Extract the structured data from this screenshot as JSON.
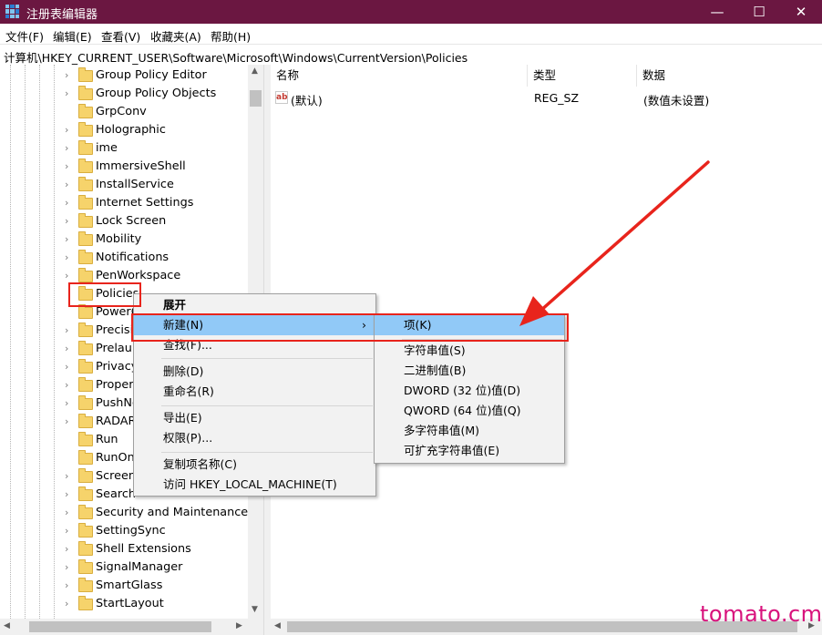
{
  "window": {
    "title": "注册表编辑器",
    "controls": {
      "minimize": "—",
      "maximize": "☐",
      "close": "✕"
    }
  },
  "menubar": {
    "items": [
      {
        "label": "文件(F)"
      },
      {
        "label": "编辑(E)"
      },
      {
        "label": "查看(V)"
      },
      {
        "label": "收藏夹(A)"
      },
      {
        "label": "帮助(H)"
      }
    ]
  },
  "address": {
    "path": "计算机\\HKEY_CURRENT_USER\\Software\\Microsoft\\Windows\\CurrentVersion\\Policies"
  },
  "tree": {
    "items": [
      {
        "label": "Group Policy Editor",
        "expandable": true
      },
      {
        "label": "Group Policy Objects",
        "expandable": true
      },
      {
        "label": "GrpConv",
        "expandable": false
      },
      {
        "label": "Holographic",
        "expandable": true
      },
      {
        "label": "ime",
        "expandable": true
      },
      {
        "label": "ImmersiveShell",
        "expandable": true
      },
      {
        "label": "InstallService",
        "expandable": true
      },
      {
        "label": "Internet Settings",
        "expandable": true
      },
      {
        "label": "Lock Screen",
        "expandable": true
      },
      {
        "label": "Mobility",
        "expandable": true
      },
      {
        "label": "Notifications",
        "expandable": true
      },
      {
        "label": "PenWorkspace",
        "expandable": true
      },
      {
        "label": "Policies",
        "expandable": false,
        "selected": true
      },
      {
        "label": "PowerC",
        "expandable": false
      },
      {
        "label": "Precisio",
        "expandable": true
      },
      {
        "label": "Prelaun",
        "expandable": true
      },
      {
        "label": "Privacy",
        "expandable": true
      },
      {
        "label": "Proper",
        "expandable": true
      },
      {
        "label": "PushNo",
        "expandable": true
      },
      {
        "label": "RADAR",
        "expandable": true
      },
      {
        "label": "Run",
        "expandable": false
      },
      {
        "label": "RunOnc",
        "expandable": false
      },
      {
        "label": "Screen",
        "expandable": true
      },
      {
        "label": "Search",
        "expandable": true
      },
      {
        "label": "Security and Maintenance",
        "expandable": true
      },
      {
        "label": "SettingSync",
        "expandable": true
      },
      {
        "label": "Shell Extensions",
        "expandable": true
      },
      {
        "label": "SignalManager",
        "expandable": true
      },
      {
        "label": "SmartGlass",
        "expandable": true
      },
      {
        "label": "StartLayout",
        "expandable": true
      }
    ]
  },
  "values_pane": {
    "columns": {
      "name": "名称",
      "type": "类型",
      "data": "数据"
    },
    "rows": [
      {
        "icon": "ab",
        "name": "(默认)",
        "type": "REG_SZ",
        "data": "(数值未设置)"
      }
    ]
  },
  "context_menu": {
    "items": [
      {
        "label": "展开",
        "bold": true
      },
      {
        "label": "新建(N)",
        "submenu_arrow": "›",
        "highlighted": true
      },
      {
        "label": "查找(F)..."
      },
      {
        "label": "删除(D)"
      },
      {
        "label": "重命名(R)"
      },
      {
        "label": "导出(E)"
      },
      {
        "label": "权限(P)..."
      },
      {
        "label": "复制项名称(C)"
      },
      {
        "label": "访问 HKEY_LOCAL_MACHINE(T)"
      }
    ]
  },
  "submenu": {
    "items": [
      {
        "label": "项(K)",
        "highlighted": true
      },
      {
        "label": "字符串值(S)"
      },
      {
        "label": "二进制值(B)"
      },
      {
        "label": "DWORD (32 位)值(D)"
      },
      {
        "label": "QWORD (64 位)值(Q)"
      },
      {
        "label": "多字符串值(M)"
      },
      {
        "label": "可扩充字符串值(E)"
      }
    ]
  },
  "watermark": {
    "text": "tomato.cm",
    "color": "#d8127c"
  },
  "colors": {
    "titlebar": "#6b1741",
    "highlight": "#91c9f7",
    "annotation": "#e8241c"
  }
}
